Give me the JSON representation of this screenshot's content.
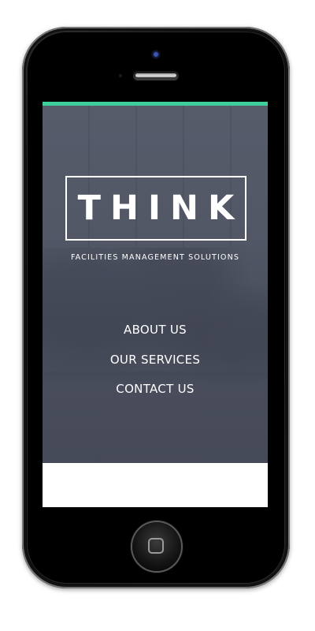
{
  "brand": {
    "logo_text": "THINK",
    "tagline": "FACILITIES MANAGEMENT SOLUTIONS"
  },
  "nav": {
    "items": [
      {
        "label": "ABOUT US"
      },
      {
        "label": "OUR SERVICES"
      },
      {
        "label": "CONTACT US"
      }
    ]
  },
  "colors": {
    "accent": "#3fcf9c",
    "hero_overlay": "#545968",
    "text": "#ffffff",
    "device_body": "#000000"
  },
  "icons": {
    "camera": "front-camera-icon",
    "speaker": "earpiece-speaker-icon",
    "home": "home-button-icon"
  }
}
